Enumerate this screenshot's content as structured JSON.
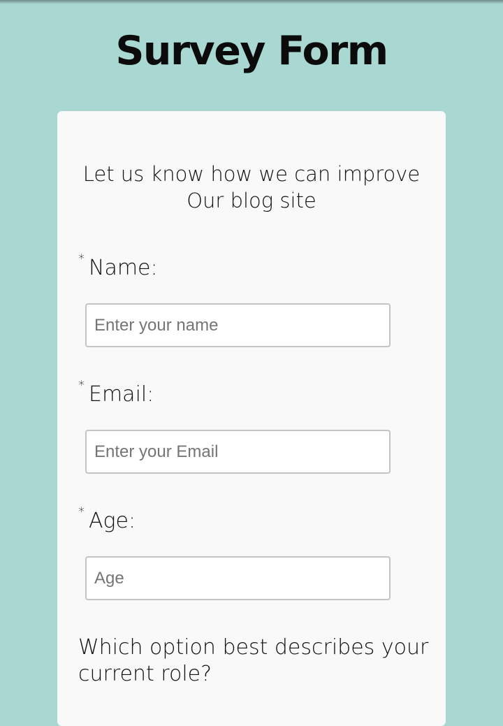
{
  "header": {
    "title": "Survey Form"
  },
  "form": {
    "description_line1": "Let us know how we can improve",
    "description_line2": "Our blog site",
    "required_marker": "*",
    "fields": [
      {
        "label": "Name:",
        "placeholder": "Enter your name",
        "value": ""
      },
      {
        "label": "Email:",
        "placeholder": "Enter your Email",
        "value": ""
      },
      {
        "label": "Age:",
        "placeholder": "Age",
        "value": ""
      }
    ],
    "role_question": "Which option best describes your current role?"
  },
  "colors": {
    "background": "#a9d8d3",
    "card": "#f9f9f9",
    "input_border": "#c4c4c4"
  }
}
